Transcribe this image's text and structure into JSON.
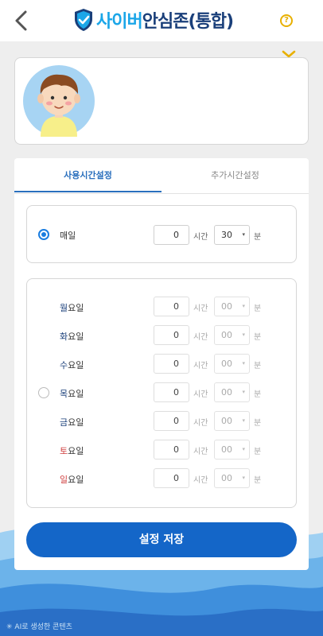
{
  "header": {
    "logo_part1": "사이버",
    "logo_part2": "안심존(통합)",
    "help_symbol": "?"
  },
  "colors": {
    "accent": "#1466c8",
    "tab_active": "#2a6fbd",
    "logo_cyan": "#1ba6e8",
    "logo_navy": "#1a3f7a",
    "help_yellow": "#e8b000",
    "weekday_mon_fri": "#1a3f7a",
    "saturday": "#d04040",
    "sunday": "#d04040"
  },
  "icons": {
    "back": "chevron-left-icon",
    "help": "question-circle-icon",
    "expand": "chevron-down-icon",
    "shield": "shield-check-icon"
  },
  "tabs": [
    {
      "label": "사용시간설정",
      "active": true
    },
    {
      "label": "추가시간설정",
      "active": false
    }
  ],
  "daily": {
    "label": "매일",
    "selected": true,
    "hours": "0",
    "hour_unit": "시간",
    "minutes": "30",
    "minute_unit": "분"
  },
  "weekly": {
    "selected": false,
    "days": [
      {
        "first": "월",
        "rest": "요일",
        "hours": "0",
        "hour_unit": "시간",
        "minutes": "00",
        "minute_unit": "분"
      },
      {
        "first": "화",
        "rest": "요일",
        "hours": "0",
        "hour_unit": "시간",
        "minutes": "00",
        "minute_unit": "분"
      },
      {
        "first": "수",
        "rest": "요일",
        "hours": "0",
        "hour_unit": "시간",
        "minutes": "00",
        "minute_unit": "분"
      },
      {
        "first": "목",
        "rest": "요일",
        "hours": "0",
        "hour_unit": "시간",
        "minutes": "00",
        "minute_unit": "분"
      },
      {
        "first": "금",
        "rest": "요일",
        "hours": "0",
        "hour_unit": "시간",
        "minutes": "00",
        "minute_unit": "분"
      },
      {
        "first": "토",
        "rest": "요일",
        "hours": "0",
        "hour_unit": "시간",
        "minutes": "00",
        "minute_unit": "분"
      },
      {
        "first": "일",
        "rest": "요일",
        "hours": "0",
        "hour_unit": "시간",
        "minutes": "00",
        "minute_unit": "분"
      }
    ]
  },
  "save_label": "설정 저장",
  "footer_note": "AI로 생성한 콘텐츠"
}
